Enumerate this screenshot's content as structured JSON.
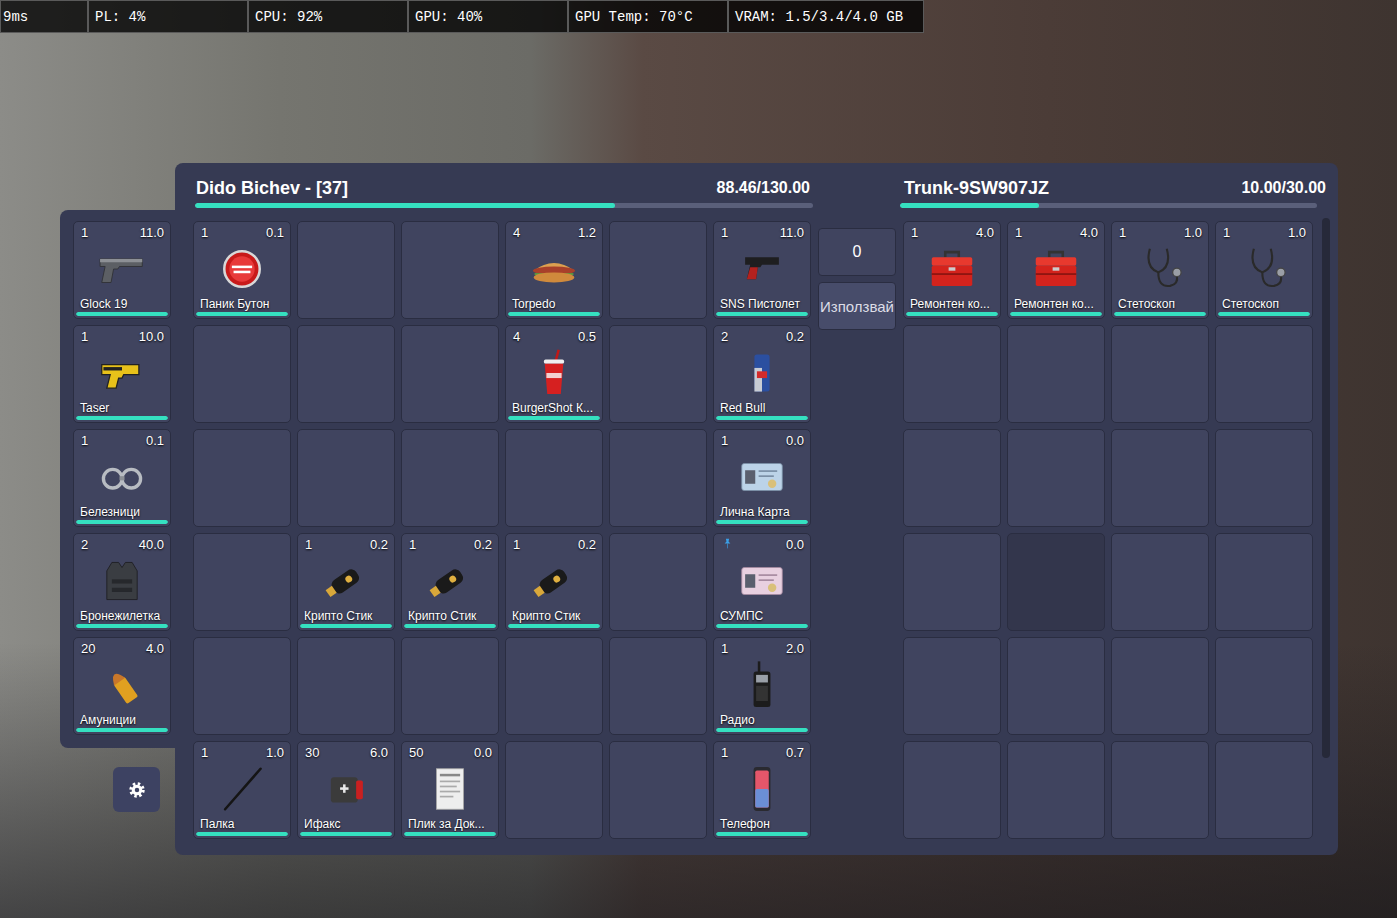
{
  "stats": [
    "9ms",
    "PL: 4%",
    "CPU: 92%",
    "GPU: 40%",
    "GPU Temp: 70°C",
    "VRAM: 1.5/3.4/4.0 GB"
  ],
  "hotbar": [
    {
      "kind": "glock",
      "label": "Glock 19",
      "count": "1",
      "weight": "11.0",
      "level": 1,
      "pinned": false
    },
    {
      "kind": "taser",
      "label": "Taser",
      "count": "1",
      "weight": "10.0",
      "level": 1,
      "pinned": false
    },
    {
      "kind": "cuffs",
      "label": "Белезници",
      "count": "1",
      "weight": "0.1",
      "level": 1,
      "pinned": false
    },
    {
      "kind": "vest",
      "label": "Бронежилетка",
      "count": "2",
      "weight": "40.0",
      "level": 1,
      "pinned": false
    },
    {
      "kind": "ammo",
      "label": "Амуниции",
      "count": "20",
      "weight": "4.0",
      "level": 1,
      "pinned": false
    }
  ],
  "player": {
    "title": "Dido Bichev - [37]",
    "weight": "88.46/130.00",
    "level": 0.68,
    "slots": [
      {
        "kind": "panic",
        "label": "Паник Бутон",
        "count": "1",
        "weight": "0.1",
        "level": 1,
        "pinned": false
      },
      {
        "kind": "empty"
      },
      {
        "kind": "empty"
      },
      {
        "kind": "torpedo",
        "label": "Torpedo",
        "count": "4",
        "weight": "1.2",
        "level": 1,
        "pinned": false
      },
      {
        "kind": "empty"
      },
      {
        "kind": "sns",
        "label": "SNS Пистолет",
        "count": "1",
        "weight": "11.0",
        "level": 1,
        "pinned": false
      },
      {
        "kind": "empty"
      },
      {
        "kind": "empty"
      },
      {
        "kind": "empty"
      },
      {
        "kind": "cup",
        "label": "BurgerShot К...",
        "count": "4",
        "weight": "0.5",
        "level": 1,
        "pinned": false
      },
      {
        "kind": "empty"
      },
      {
        "kind": "can",
        "label": "Red Bull",
        "count": "2",
        "weight": "0.2",
        "level": 1,
        "pinned": false
      },
      {
        "kind": "empty"
      },
      {
        "kind": "empty"
      },
      {
        "kind": "empty"
      },
      {
        "kind": "empty"
      },
      {
        "kind": "empty"
      },
      {
        "kind": "idcard",
        "label": "Лична Карта",
        "count": "1",
        "weight": "0.0",
        "level": 1,
        "pinned": false
      },
      {
        "kind": "empty"
      },
      {
        "kind": "crypto",
        "label": "Крипто Стик",
        "count": "1",
        "weight": "0.2",
        "level": 1,
        "pinned": false
      },
      {
        "kind": "crypto",
        "label": "Крипто Стик",
        "count": "1",
        "weight": "0.2",
        "level": 1,
        "pinned": false
      },
      {
        "kind": "crypto",
        "label": "Крипто Стик",
        "count": "1",
        "weight": "0.2",
        "level": 1,
        "pinned": false
      },
      {
        "kind": "empty"
      },
      {
        "kind": "license",
        "label": "СУМПС",
        "weight": "0.0",
        "level": 1,
        "pinned": true
      },
      {
        "kind": "empty"
      },
      {
        "kind": "empty"
      },
      {
        "kind": "empty"
      },
      {
        "kind": "empty"
      },
      {
        "kind": "empty"
      },
      {
        "kind": "radio",
        "label": "Радио",
        "count": "1",
        "weight": "2.0",
        "level": 1,
        "pinned": false
      },
      {
        "kind": "baton",
        "label": "Палка",
        "count": "1",
        "weight": "1.0",
        "level": 1,
        "pinned": false
      },
      {
        "kind": "ifak",
        "label": "Ифакс",
        "count": "30",
        "weight": "6.0",
        "level": 1,
        "pinned": false
      },
      {
        "kind": "docbag",
        "label": "Плик за Док...",
        "count": "50",
        "weight": "0.0",
        "level": 1,
        "pinned": false
      },
      {
        "kind": "empty"
      },
      {
        "kind": "empty"
      },
      {
        "kind": "phone",
        "label": "Телефон",
        "count": "1",
        "weight": "0.7",
        "level": 1,
        "pinned": false
      }
    ]
  },
  "actions": {
    "amount": "0",
    "use_button": "Използвай"
  },
  "trunk": {
    "title": "Trunk-9SW907JZ",
    "weight": "10.00/30.00",
    "level": 0.333,
    "slots": [
      {
        "kind": "toolbox",
        "label": "Ремонтен ко...",
        "count": "1",
        "weight": "4.0",
        "level": 1,
        "pinned": false,
        "hovered": false
      },
      {
        "kind": "toolbox",
        "label": "Ремонтен ко...",
        "count": "1",
        "weight": "4.0",
        "level": 1,
        "pinned": false,
        "hovered": false
      },
      {
        "kind": "stethoscope",
        "label": "Стетоскоп",
        "count": "1",
        "weight": "1.0",
        "level": 1,
        "pinned": false,
        "hovered": false
      },
      {
        "kind": "stethoscope",
        "label": "Стетоскоп",
        "count": "1",
        "weight": "1.0",
        "level": 1,
        "pinned": false,
        "hovered": false
      },
      {
        "kind": "empty",
        "hovered": false
      },
      {
        "kind": "empty",
        "hovered": false
      },
      {
        "kind": "empty",
        "hovered": false
      },
      {
        "kind": "empty",
        "hovered": false
      },
      {
        "kind": "empty",
        "hovered": false
      },
      {
        "kind": "empty",
        "hovered": false
      },
      {
        "kind": "empty",
        "hovered": false
      },
      {
        "kind": "empty",
        "hovered": false
      },
      {
        "kind": "empty",
        "hovered": false
      },
      {
        "kind": "empty",
        "hovered": true
      },
      {
        "kind": "empty",
        "hovered": false
      },
      {
        "kind": "empty",
        "hovered": false
      },
      {
        "kind": "empty",
        "hovered": false
      },
      {
        "kind": "empty",
        "hovered": false
      },
      {
        "kind": "empty",
        "hovered": false
      },
      {
        "kind": "empty",
        "hovered": false
      },
      {
        "kind": "empty",
        "hovered": false
      },
      {
        "kind": "empty",
        "hovered": false
      },
      {
        "kind": "empty",
        "hovered": false
      },
      {
        "kind": "empty",
        "hovered": false
      }
    ]
  }
}
